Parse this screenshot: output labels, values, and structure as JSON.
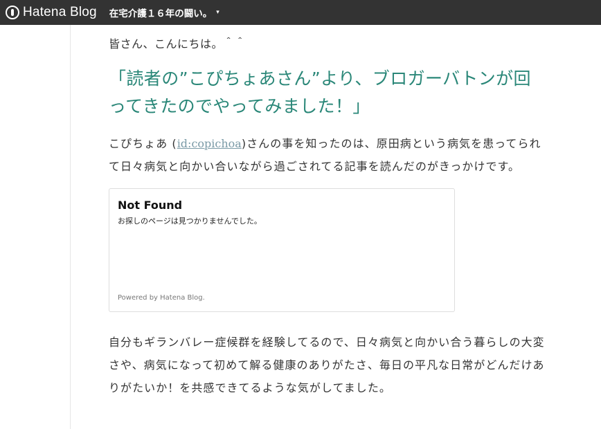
{
  "topbar": {
    "brand": "Hatena Blog",
    "blog_title": "在宅介護１６年の闘い。",
    "caret": "▾"
  },
  "article": {
    "greeting": "皆さん、こんにちは。＾＾",
    "heading": "「読者の”こぴちょあさん”より、ブロガーバトンが回ってきたのでやってみました！」",
    "para1_pre": "こぴちょあ (",
    "para1_link": "id:copichoa",
    "para1_post": ")さんの事を知ったのは、原田病という病気を患ってられて日々病気と向かい合いながら過ごされてる記事を読んだのがきっかけです。",
    "embed": {
      "title": "Not Found",
      "message": "お探しのページは見つかりませんでした。",
      "footer": "Powered by Hatena Blog."
    },
    "para2": "自分もギランバレー症候群を経験してるので、日々病気と向かい合う暮らしの大変さや、病気になって初めて解る健康のありがたさ、毎日の平凡な日常がどんだけありがたいか！を共感できてるような気がしてました。"
  }
}
